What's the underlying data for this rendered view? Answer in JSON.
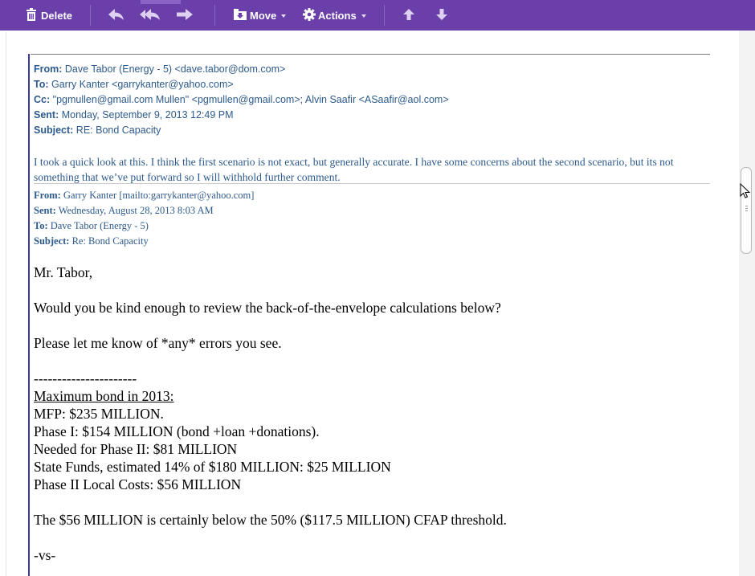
{
  "toolbar": {
    "delete_label": "Delete",
    "move_label": "Move",
    "actions_label": "Actions",
    "icons": [
      "trash-icon",
      "reply-icon",
      "reply-all-icon",
      "forward-icon",
      "move-icon",
      "gear-icon",
      "previous-icon",
      "next-icon"
    ]
  },
  "reply": {
    "from_label": "From:",
    "from": "Dave Tabor (Energy - 5) <dave.tabor@dom.com>",
    "to_label": "To:",
    "to": "Garry Kanter <garrykanter@yahoo.com>",
    "cc_label": "Cc:",
    "cc": "\"pgmullen@gmail.com Mullen\" <pgmullen@gmail.com>; Alvin Saafir <ASaafir@aol.com>",
    "sent_label": "Sent:",
    "sent": "Monday, September 9, 2013 12:49 PM",
    "subject_label": "Subject:",
    "subject": "RE: Bond Capacity",
    "body": "I took a quick look at this. I think the first scenario is not exact, but generally accurate. I have some concerns about the second scenario, but its not something that we’ve put forward so I will withhold further comment."
  },
  "original": {
    "from_label": "From:",
    "from": "Garry Kanter [mailto:garrykanter@yahoo.com]",
    "sent_label": "Sent:",
    "sent": "Wednesday, August 28, 2013 8:03 AM",
    "to_label": "To:",
    "to": "Dave Tabor (Energy - 5)",
    "subject_label": "Subject:",
    "subject": "Re: Bond Capacity",
    "lines": {
      "greeting": "Mr. Tabor,",
      "request": "Would you be kind enough to review the back-of-the-envelope calculations below?",
      "errors": "Please let me know of *any* errors you see.",
      "dashes": "----------------------",
      "heading": "Maximum bond in 2013:",
      "mfp": "MFP: $235 MILLION.",
      "phase1": "Phase I: $154 MILLION (bond +loan +donations).",
      "needed": "Needed for Phase II: $81 MILLION",
      "state": "State Funds, estimated 14% of $180 MILLION: $25 MILLION",
      "local": "Phase II Local Costs: $56 MILLION",
      "threshold": "The $56 MILLION is certainly below the 50% ($117.5 MILLION) CFAP threshold.",
      "vs": "-vs-"
    }
  },
  "colors": {
    "toolbar": "#6b3fa9",
    "header_text": "#2d5a8c",
    "quote_bar": "#3a3c9a"
  }
}
